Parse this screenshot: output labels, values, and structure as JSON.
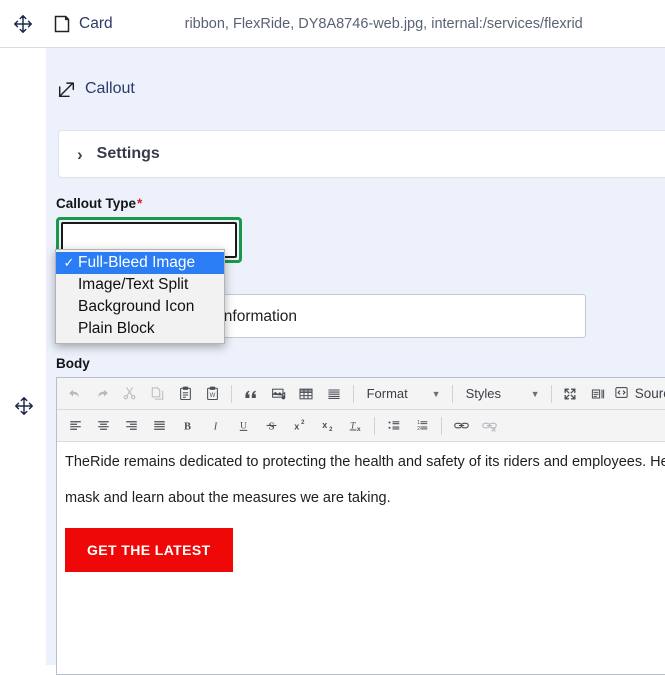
{
  "header": {
    "drag_icon": "move-icon",
    "type_icon": "card-icon",
    "type_label": "Card",
    "summary": "ribbon, FlexRide, DY8A8746-web.jpg, internal:/services/flexrid"
  },
  "rail": {
    "move_icon": "move-icon"
  },
  "callout": {
    "icon": "external-link-icon",
    "label": "Callout"
  },
  "settings": {
    "chevron": "chevron-right-icon",
    "title": "Settings"
  },
  "callout_type": {
    "label": "Callout Type",
    "required_marker": "*",
    "selected": "Full-Bleed Image",
    "checkmark": "✓",
    "options": [
      "Full-Bleed Image",
      "Image/Text Split",
      "Background Icon",
      "Plain Block"
    ]
  },
  "title_field": {
    "value": "COVID-19 Updates & Information",
    "placeholder": ""
  },
  "body_field": {
    "label": "Body",
    "toolbar_row1": [
      {
        "name": "undo-icon",
        "label": "Undo",
        "dim": true
      },
      {
        "name": "redo-icon",
        "label": "Redo",
        "dim": true
      },
      {
        "name": "cut-icon",
        "label": "Cut",
        "dim": true
      },
      {
        "name": "copy-icon",
        "label": "Copy",
        "dim": true
      },
      {
        "name": "paste-icon",
        "label": "Paste",
        "dim": false
      },
      {
        "name": "paste-from-word-icon",
        "label": "Paste from Word",
        "dim": false
      },
      {
        "name": "blockquote-icon",
        "label": "Block Quote",
        "dim": false
      },
      {
        "name": "media-embed-icon",
        "label": "Media",
        "dim": false
      },
      {
        "name": "table-icon",
        "label": "Table",
        "dim": false
      },
      {
        "name": "horizontal-rule-icon",
        "label": "Horizontal Line",
        "dim": false
      }
    ],
    "format_dropdown": "Format",
    "styles_dropdown": "Styles",
    "maximize_icon": "maximize-icon",
    "show_blocks_icon": "show-blocks-icon",
    "source_icon": "source-code-icon",
    "source_label": "Sourc",
    "toolbar_row2": [
      {
        "name": "align-left-icon",
        "label": "Align Left"
      },
      {
        "name": "align-center-icon",
        "label": "Center"
      },
      {
        "name": "align-right-icon",
        "label": "Align Right"
      },
      {
        "name": "justify-icon",
        "label": "Justify"
      },
      {
        "name": "bold-icon",
        "label": "Bold"
      },
      {
        "name": "italic-icon",
        "label": "Italic"
      },
      {
        "name": "underline-icon",
        "label": "Underline"
      },
      {
        "name": "strikethrough-icon",
        "label": "Strikethrough"
      },
      {
        "name": "superscript-icon",
        "label": "Superscript"
      },
      {
        "name": "subscript-icon",
        "label": "Subscript"
      },
      {
        "name": "remove-format-icon",
        "label": "Remove Format"
      },
      {
        "name": "bulleted-list-icon",
        "label": "Bulleted List"
      },
      {
        "name": "numbered-list-icon",
        "label": "Numbered List"
      },
      {
        "name": "link-icon",
        "label": "Link"
      },
      {
        "name": "unlink-icon",
        "label": "Unlink"
      }
    ],
    "content_line1": "TheRide remains dedicated to protecting the health and safety of its riders and employees. Help ke",
    "content_line2": "mask and learn about the measures we are taking.",
    "cta_label": "GET THE LATEST"
  },
  "colors": {
    "panel_bg": "#edf1fb",
    "focus_ring": "#1a9949",
    "dropdown_highlight": "#2a7df4",
    "cta_red": "#ef0808",
    "required_red": "#d72222",
    "link_navy": "#2b3a67"
  }
}
